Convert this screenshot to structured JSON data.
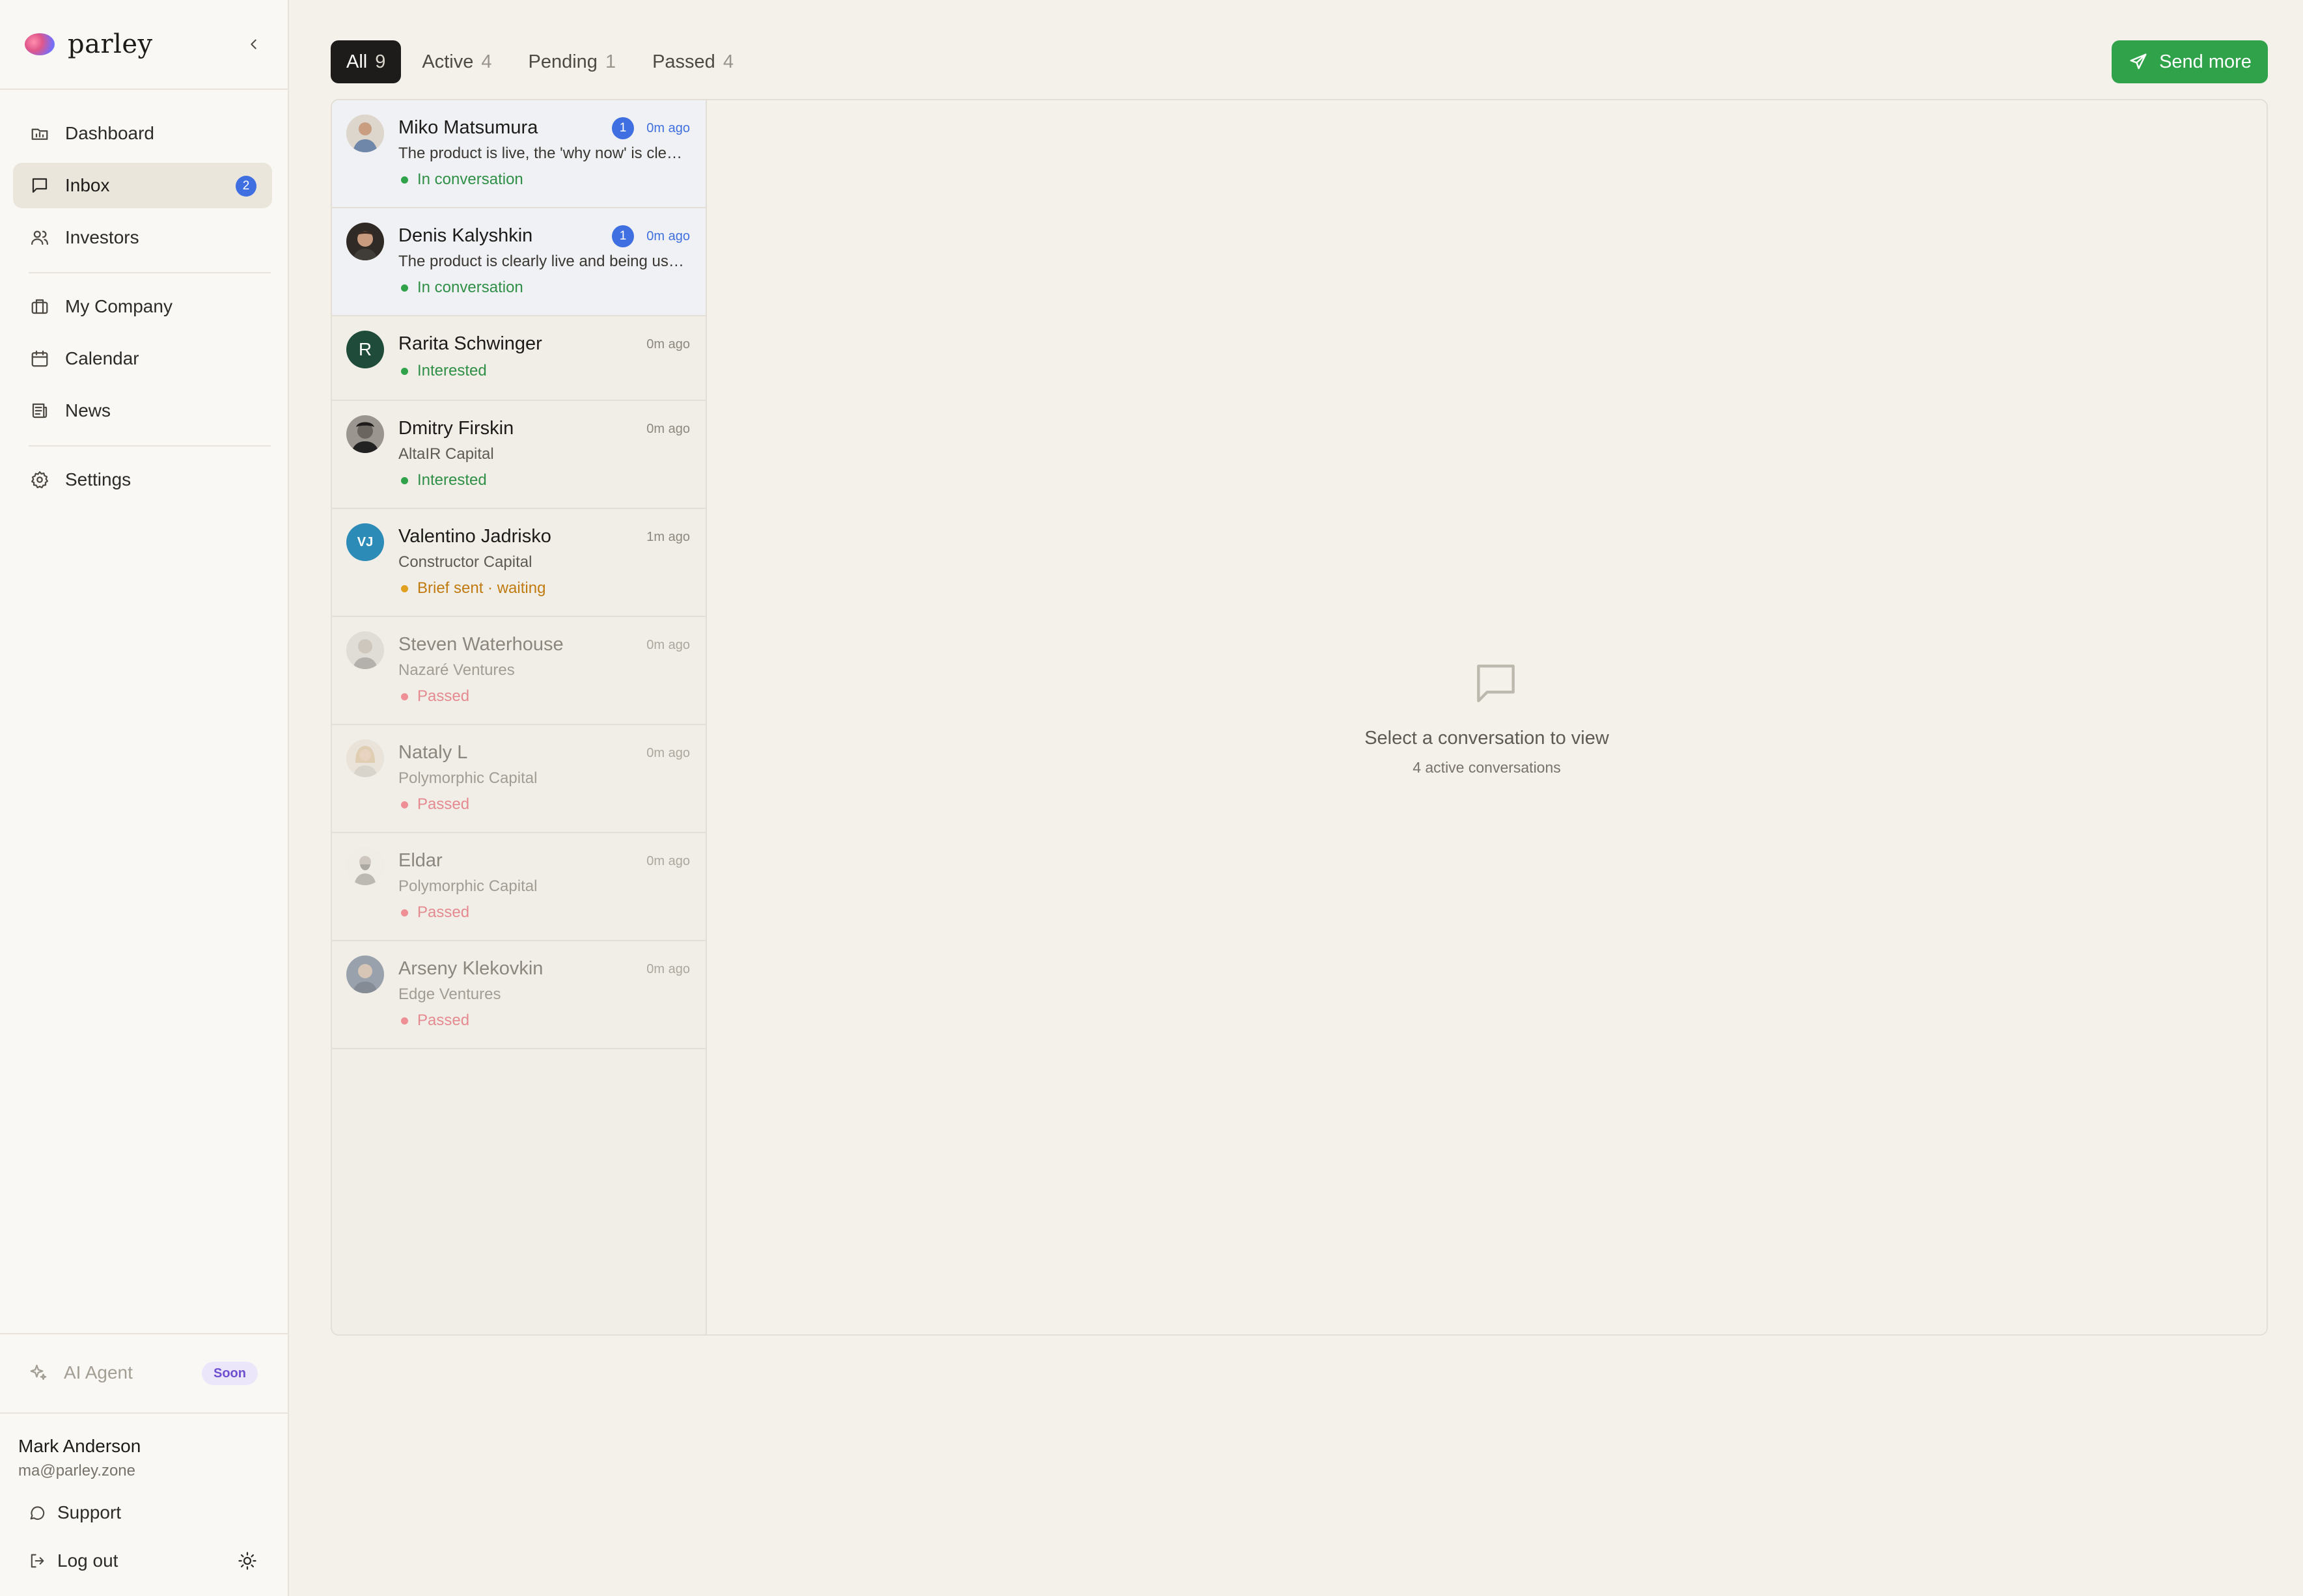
{
  "app": {
    "name": "parley"
  },
  "sidebar": {
    "nav": [
      {
        "label": "Dashboard",
        "icon": "dashboard-icon"
      },
      {
        "label": "Inbox",
        "icon": "message-square-icon",
        "badge": "2",
        "active": true
      },
      {
        "label": "Investors",
        "icon": "users-icon"
      },
      {
        "label": "My Company",
        "icon": "briefcase-icon"
      },
      {
        "label": "Calendar",
        "icon": "calendar-icon"
      },
      {
        "label": "News",
        "icon": "newspaper-icon"
      },
      {
        "label": "Settings",
        "icon": "gear-icon"
      }
    ],
    "ai_agent": {
      "label": "AI Agent",
      "badge": "Soon"
    },
    "user": {
      "name": "Mark Anderson",
      "email": "ma@parley.zone"
    },
    "support_label": "Support",
    "logout_label": "Log out"
  },
  "tabs": [
    {
      "label": "All",
      "count": "9",
      "active": true
    },
    {
      "label": "Active",
      "count": "4"
    },
    {
      "label": "Pending",
      "count": "1"
    },
    {
      "label": "Passed",
      "count": "4"
    }
  ],
  "send_more_label": "Send more",
  "conversations": [
    {
      "name": "Miko Matsumura",
      "time": "0m ago",
      "unread": "1",
      "sub": "The product is live, the 'why now' is clear, and the business model is...",
      "status": "In conversation",
      "status_color": "#2fa24a"
    },
    {
      "name": "Denis Kalyshkin",
      "time": "0m ago",
      "unread": "1",
      "sub": "The product is clearly live and being used by real customers...",
      "status": "In conversation",
      "status_color": "#2fa24a"
    },
    {
      "name": "Rarita Schwinger",
      "time": "0m ago",
      "avatar_initials": "R",
      "status": "Interested",
      "status_color": "#2fa24a"
    },
    {
      "name": "Dmitry Firskin",
      "time": "0m ago",
      "sub": "AltaIR Capital",
      "status": "Interested",
      "status_color": "#2fa24a"
    },
    {
      "name": "Valentino Jadrisko",
      "time": "1m ago",
      "avatar_initials": "VJ",
      "sub": "Constructor Capital",
      "status": "Brief sent · waiting",
      "status_color": "#e0a020",
      "status_text_color": "#c07a10"
    },
    {
      "name": "Steven Waterhouse",
      "time": "0m ago",
      "sub": "Nazaré Ventures",
      "status": "Passed",
      "status_color": "#ee8e95"
    },
    {
      "name": "Nataly L",
      "time": "0m ago",
      "sub": "Polymorphic Capital",
      "status": "Passed",
      "status_color": "#ee8e95"
    },
    {
      "name": "Eldar",
      "time": "0m ago",
      "sub": "Polymorphic Capital",
      "status": "Passed",
      "status_color": "#ee8e95"
    },
    {
      "name": "Arseny Klekovkin",
      "time": "0m ago",
      "sub": "Edge Ventures",
      "status": "Passed",
      "status_color": "#ee8e95"
    }
  ],
  "empty_state": {
    "title": "Select a conversation to view",
    "subtitle": "4 active conversations"
  },
  "colors": {
    "accent_blue": "#3f6fe0",
    "accent_green": "#2fa24a"
  }
}
